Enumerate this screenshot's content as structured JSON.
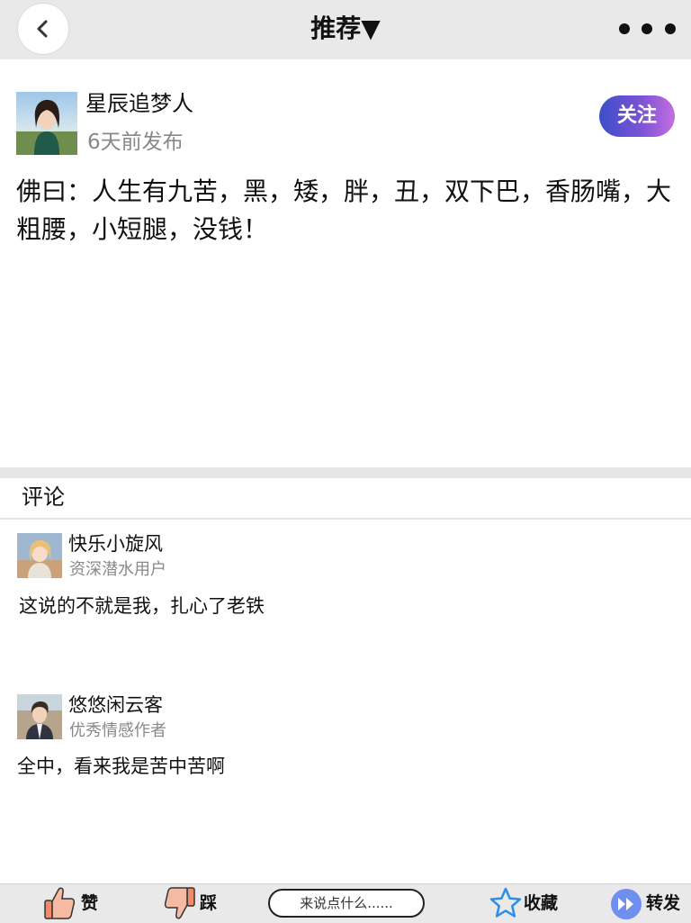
{
  "header": {
    "title": "推荐▼",
    "back_icon": "chevron-left-icon",
    "more_icon": "more-dots-icon"
  },
  "post": {
    "author": "星辰追梦人",
    "time": "6天前发布",
    "follow_label": "关注",
    "content": "佛曰：人生有九苦，黑，矮，胖，丑，双下巴，香肠嘴，大粗腰，小短腿，没钱！"
  },
  "comments": {
    "title": "评论",
    "items": [
      {
        "name": "快乐小旋风",
        "role": "资深潜水用户",
        "text": "这说的不就是我，扎心了老铁"
      },
      {
        "name": "悠悠闲云客",
        "role": "优秀情感作者",
        "text": "全中，看来我是苦中苦啊"
      }
    ]
  },
  "bottom_bar": {
    "like_label": "赞",
    "dislike_label": "踩",
    "input_placeholder": "来说点什么......",
    "favorite_label": "收藏",
    "share_label": "转发"
  },
  "colors": {
    "bar_background": "#e9e9e9",
    "follow_gradient_start": "#3b4fc9",
    "follow_gradient_end": "#c46ee0",
    "muted_text": "#888888"
  }
}
